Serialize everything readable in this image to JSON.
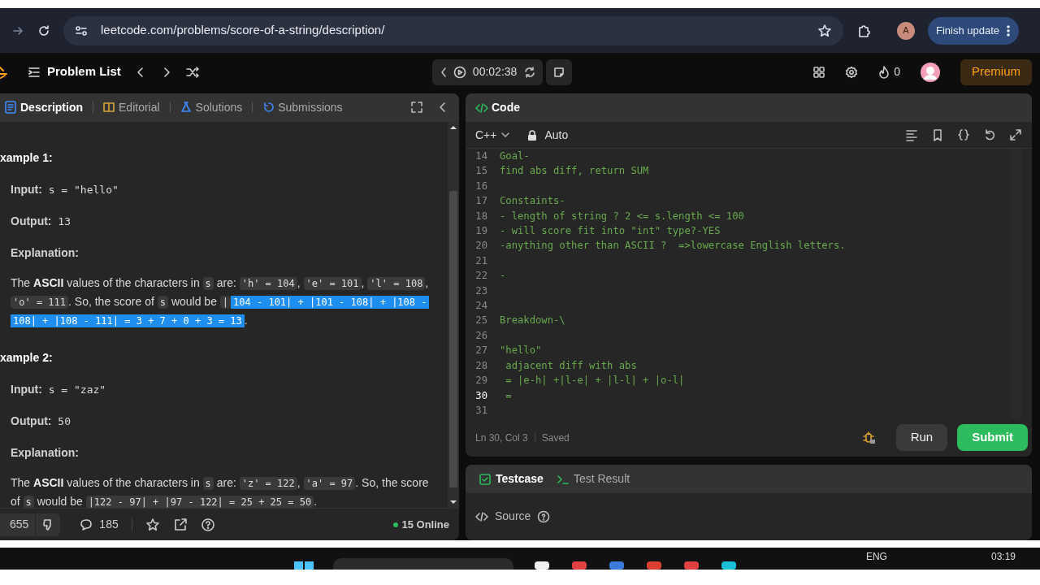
{
  "browser": {
    "url": "leetcode.com/problems/score-of-a-string/description/",
    "profile_initial": "A",
    "update_button": "Finish update"
  },
  "nav": {
    "problem_list": "Problem List",
    "timer": "00:02:38",
    "streak": "0",
    "premium": "Premium"
  },
  "description_panel": {
    "tabs": [
      {
        "label": "Description",
        "selected": true
      },
      {
        "label": "Editorial",
        "selected": false
      },
      {
        "label": "Solutions",
        "selected": false
      },
      {
        "label": "Submissions",
        "selected": false
      }
    ],
    "examples": [
      {
        "title": "xample 1:",
        "input_label": "Input:",
        "input": "s = \"hello\"",
        "output_label": "Output:",
        "output": "13",
        "explanation_label": "Explanation:",
        "explanation": [
          {
            "kind": "text",
            "text": "The "
          },
          {
            "kind": "bold",
            "text": "ASCII"
          },
          {
            "kind": "text",
            "text": " values of the characters in "
          },
          {
            "kind": "code",
            "text": "s",
            "selected": false
          },
          {
            "kind": "text",
            "text": " are: "
          },
          {
            "kind": "code",
            "text": "'h' = 104",
            "selected": false
          },
          {
            "kind": "text",
            "text": ", "
          },
          {
            "kind": "code",
            "text": "'e' = 101",
            "selected": false
          },
          {
            "kind": "text",
            "text": ", "
          },
          {
            "kind": "code",
            "text": "'l' = 108",
            "selected": false
          },
          {
            "kind": "text",
            "text": ", "
          },
          {
            "kind": "code",
            "text": "'o' = 111",
            "selected": false
          },
          {
            "kind": "text",
            "text": ". So, the score of "
          },
          {
            "kind": "code",
            "text": "s",
            "selected": false
          },
          {
            "kind": "text",
            "text": " would be "
          },
          {
            "kind": "code",
            "text": "|",
            "selected": false
          },
          {
            "kind": "code",
            "text": "104 - 101| + |101 - 108| + |108 - 108| + |108 - 111| = 3 + 7 + 0 + 3 = 13",
            "selected": true
          },
          {
            "kind": "text",
            "text": "."
          }
        ]
      },
      {
        "title": "xample 2:",
        "input_label": "Input:",
        "input": "s = \"zaz\"",
        "output_label": "Output:",
        "output": "50",
        "explanation_label": "Explanation:",
        "explanation": [
          {
            "kind": "text",
            "text": "The "
          },
          {
            "kind": "bold",
            "text": "ASCII"
          },
          {
            "kind": "text",
            "text": " values of the characters in "
          },
          {
            "kind": "code",
            "text": "s",
            "selected": false
          },
          {
            "kind": "text",
            "text": " are: "
          },
          {
            "kind": "code",
            "text": "'z' = 122",
            "selected": false
          },
          {
            "kind": "text",
            "text": ", "
          },
          {
            "kind": "code",
            "text": "'a' = 97",
            "selected": false
          },
          {
            "kind": "text",
            "text": ". So, the score of "
          },
          {
            "kind": "code",
            "text": "s",
            "selected": false
          },
          {
            "kind": "text",
            "text": " would be "
          },
          {
            "kind": "code",
            "text": "|122 - 97| + |97 - 122| = 25 + 25 = 50",
            "selected": false
          },
          {
            "kind": "text",
            "text": "."
          }
        ]
      }
    ],
    "footer": {
      "likes": "655",
      "comments": "185",
      "online": "15 Online"
    }
  },
  "code_panel": {
    "title": "Code",
    "language": "C++",
    "mode": "Auto",
    "lines": [
      {
        "number": "14",
        "text": "Goal-",
        "current": false
      },
      {
        "number": "15",
        "text": "find abs diff, return SUM",
        "current": false
      },
      {
        "number": "16",
        "current": false
      },
      {
        "number": "17",
        "text": "Constaints-",
        "current": false
      },
      {
        "number": "18",
        "text": "- length of string ? 2 <= s.length <= 100",
        "current": false
      },
      {
        "number": "19",
        "text": "- will score fit into \"int\" type?-YES",
        "current": false
      },
      {
        "number": "20",
        "text": "-anything other than ASCII ?  =>lowercase English letters.",
        "current": false
      },
      {
        "number": "21",
        "current": false
      },
      {
        "number": "22",
        "text": "-",
        "current": false
      },
      {
        "number": "23",
        "current": false
      },
      {
        "number": "24",
        "current": false
      },
      {
        "number": "25",
        "text": "Breakdown-\\",
        "current": false
      },
      {
        "number": "26",
        "current": false
      },
      {
        "number": "27",
        "text": "\"hello\"",
        "current": false
      },
      {
        "number": "28",
        "text": " adjacent diff with abs",
        "current": false
      },
      {
        "number": "29",
        "text": " = |e-h| +|l-e| + |l-l| + |o-l|",
        "current": false
      },
      {
        "number": "30",
        "text": " =",
        "current": true
      },
      {
        "number": "31",
        "current": false
      }
    ],
    "status": "Ln 30, Col 3",
    "saved": "Saved",
    "run": "Run",
    "submit": "Submit"
  },
  "test_panel": {
    "tabs": [
      {
        "label": "Testcase",
        "selected": true
      },
      {
        "label": "Test Result",
        "selected": false
      }
    ],
    "source": "Source"
  },
  "taskbar": {
    "language": "ENG",
    "time": "03:19"
  }
}
